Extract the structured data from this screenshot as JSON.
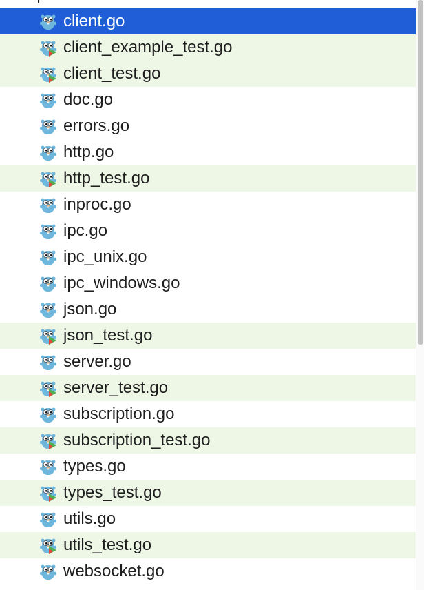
{
  "folder": {
    "name": "ipc",
    "icon": "folder-icon"
  },
  "colors": {
    "selected_bg": "#1f5ed6",
    "test_row_bg": "#eef7e6",
    "gopher_body": "#6fb6dd",
    "test_badge_green": "#4caf50",
    "test_badge_red": "#e0483a"
  },
  "files": [
    {
      "name": "client.go",
      "is_test": false,
      "selected": true
    },
    {
      "name": "client_example_test.go",
      "is_test": true,
      "selected": false
    },
    {
      "name": "client_test.go",
      "is_test": true,
      "selected": false
    },
    {
      "name": "doc.go",
      "is_test": false,
      "selected": false
    },
    {
      "name": "errors.go",
      "is_test": false,
      "selected": false
    },
    {
      "name": "http.go",
      "is_test": false,
      "selected": false
    },
    {
      "name": "http_test.go",
      "is_test": true,
      "selected": false
    },
    {
      "name": "inproc.go",
      "is_test": false,
      "selected": false
    },
    {
      "name": "ipc.go",
      "is_test": false,
      "selected": false
    },
    {
      "name": "ipc_unix.go",
      "is_test": false,
      "selected": false
    },
    {
      "name": "ipc_windows.go",
      "is_test": false,
      "selected": false
    },
    {
      "name": "json.go",
      "is_test": false,
      "selected": false
    },
    {
      "name": "json_test.go",
      "is_test": true,
      "selected": false
    },
    {
      "name": "server.go",
      "is_test": false,
      "selected": false
    },
    {
      "name": "server_test.go",
      "is_test": true,
      "selected": false
    },
    {
      "name": "subscription.go",
      "is_test": false,
      "selected": false
    },
    {
      "name": "subscription_test.go",
      "is_test": true,
      "selected": false
    },
    {
      "name": "types.go",
      "is_test": false,
      "selected": false
    },
    {
      "name": "types_test.go",
      "is_test": true,
      "selected": false
    },
    {
      "name": "utils.go",
      "is_test": false,
      "selected": false
    },
    {
      "name": "utils_test.go",
      "is_test": true,
      "selected": false
    },
    {
      "name": "websocket.go",
      "is_test": false,
      "selected": false
    }
  ]
}
